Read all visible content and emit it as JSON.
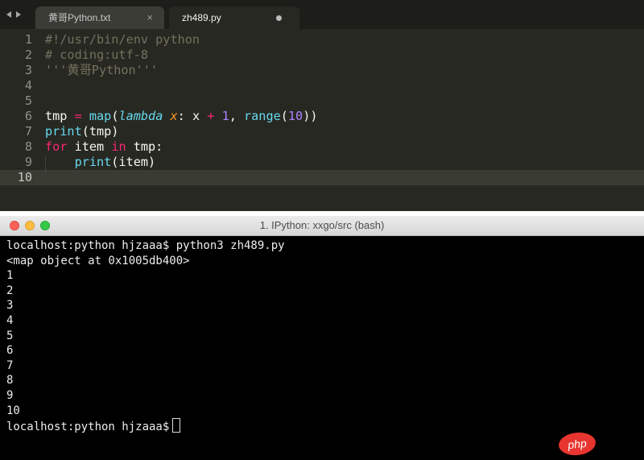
{
  "editor": {
    "tabs": [
      {
        "label": "黄哥Python.txt",
        "close_glyph": "×"
      },
      {
        "label": "zh489.py"
      }
    ],
    "lines": [
      {
        "n": "1",
        "parts": [
          {
            "t": "#!/usr/bin/env python",
            "c": "comment"
          }
        ]
      },
      {
        "n": "2",
        "parts": [
          {
            "t": "# coding:utf-8",
            "c": "comment"
          }
        ]
      },
      {
        "n": "3",
        "parts": [
          {
            "t": "'''黄哥Python'''",
            "c": "string"
          }
        ]
      },
      {
        "n": "4",
        "parts": []
      },
      {
        "n": "5",
        "parts": []
      },
      {
        "n": "6",
        "parts": [
          {
            "t": "tmp ",
            "c": ""
          },
          {
            "t": "=",
            "c": "kw"
          },
          {
            "t": " ",
            "c": ""
          },
          {
            "t": "map",
            "c": "builtin"
          },
          {
            "t": "(",
            "c": ""
          },
          {
            "t": "lambda",
            "c": "italic-kw"
          },
          {
            "t": " ",
            "c": ""
          },
          {
            "t": "x",
            "c": "param"
          },
          {
            "t": ": x ",
            "c": ""
          },
          {
            "t": "+",
            "c": "kw"
          },
          {
            "t": " ",
            "c": ""
          },
          {
            "t": "1",
            "c": "num"
          },
          {
            "t": ", ",
            "c": ""
          },
          {
            "t": "range",
            "c": "builtin"
          },
          {
            "t": "(",
            "c": ""
          },
          {
            "t": "10",
            "c": "num"
          },
          {
            "t": "))",
            "c": ""
          }
        ]
      },
      {
        "n": "7",
        "parts": [
          {
            "t": "print",
            "c": "builtin"
          },
          {
            "t": "(tmp)",
            "c": ""
          }
        ]
      },
      {
        "n": "8",
        "parts": [
          {
            "t": "for",
            "c": "kw"
          },
          {
            "t": " item ",
            "c": ""
          },
          {
            "t": "in",
            "c": "kw"
          },
          {
            "t": " tmp:",
            "c": ""
          }
        ]
      },
      {
        "n": "9",
        "parts": [
          {
            "t": "    ",
            "c": ""
          },
          {
            "t": "print",
            "c": "builtin"
          },
          {
            "t": "(item)",
            "c": ""
          }
        ]
      },
      {
        "n": "10",
        "parts": [],
        "current": true
      }
    ]
  },
  "terminal": {
    "title": "1. IPython: xxgo/src (bash)",
    "lines": [
      "localhost:python hjzaaa$ python3 zh489.py",
      "<map object at 0x1005db400>",
      "1",
      "2",
      "3",
      "4",
      "5",
      "6",
      "7",
      "8",
      "9",
      "10"
    ],
    "prompt": "localhost:python hjzaaa$"
  },
  "watermark": {
    "text": "php"
  },
  "colors": {
    "editor_bg": "#272822",
    "terminal_bg": "#000000",
    "keyword": "#f92672",
    "builtin": "#66d9ef",
    "number": "#ae81ff",
    "param": "#fd971f",
    "comment": "#75715e",
    "watermark_bg": "#e8352f"
  },
  "icons": [
    "arrow-left-icon",
    "arrow-right-icon",
    "close-icon",
    "unsaved-dot-icon",
    "cursor-block"
  ]
}
